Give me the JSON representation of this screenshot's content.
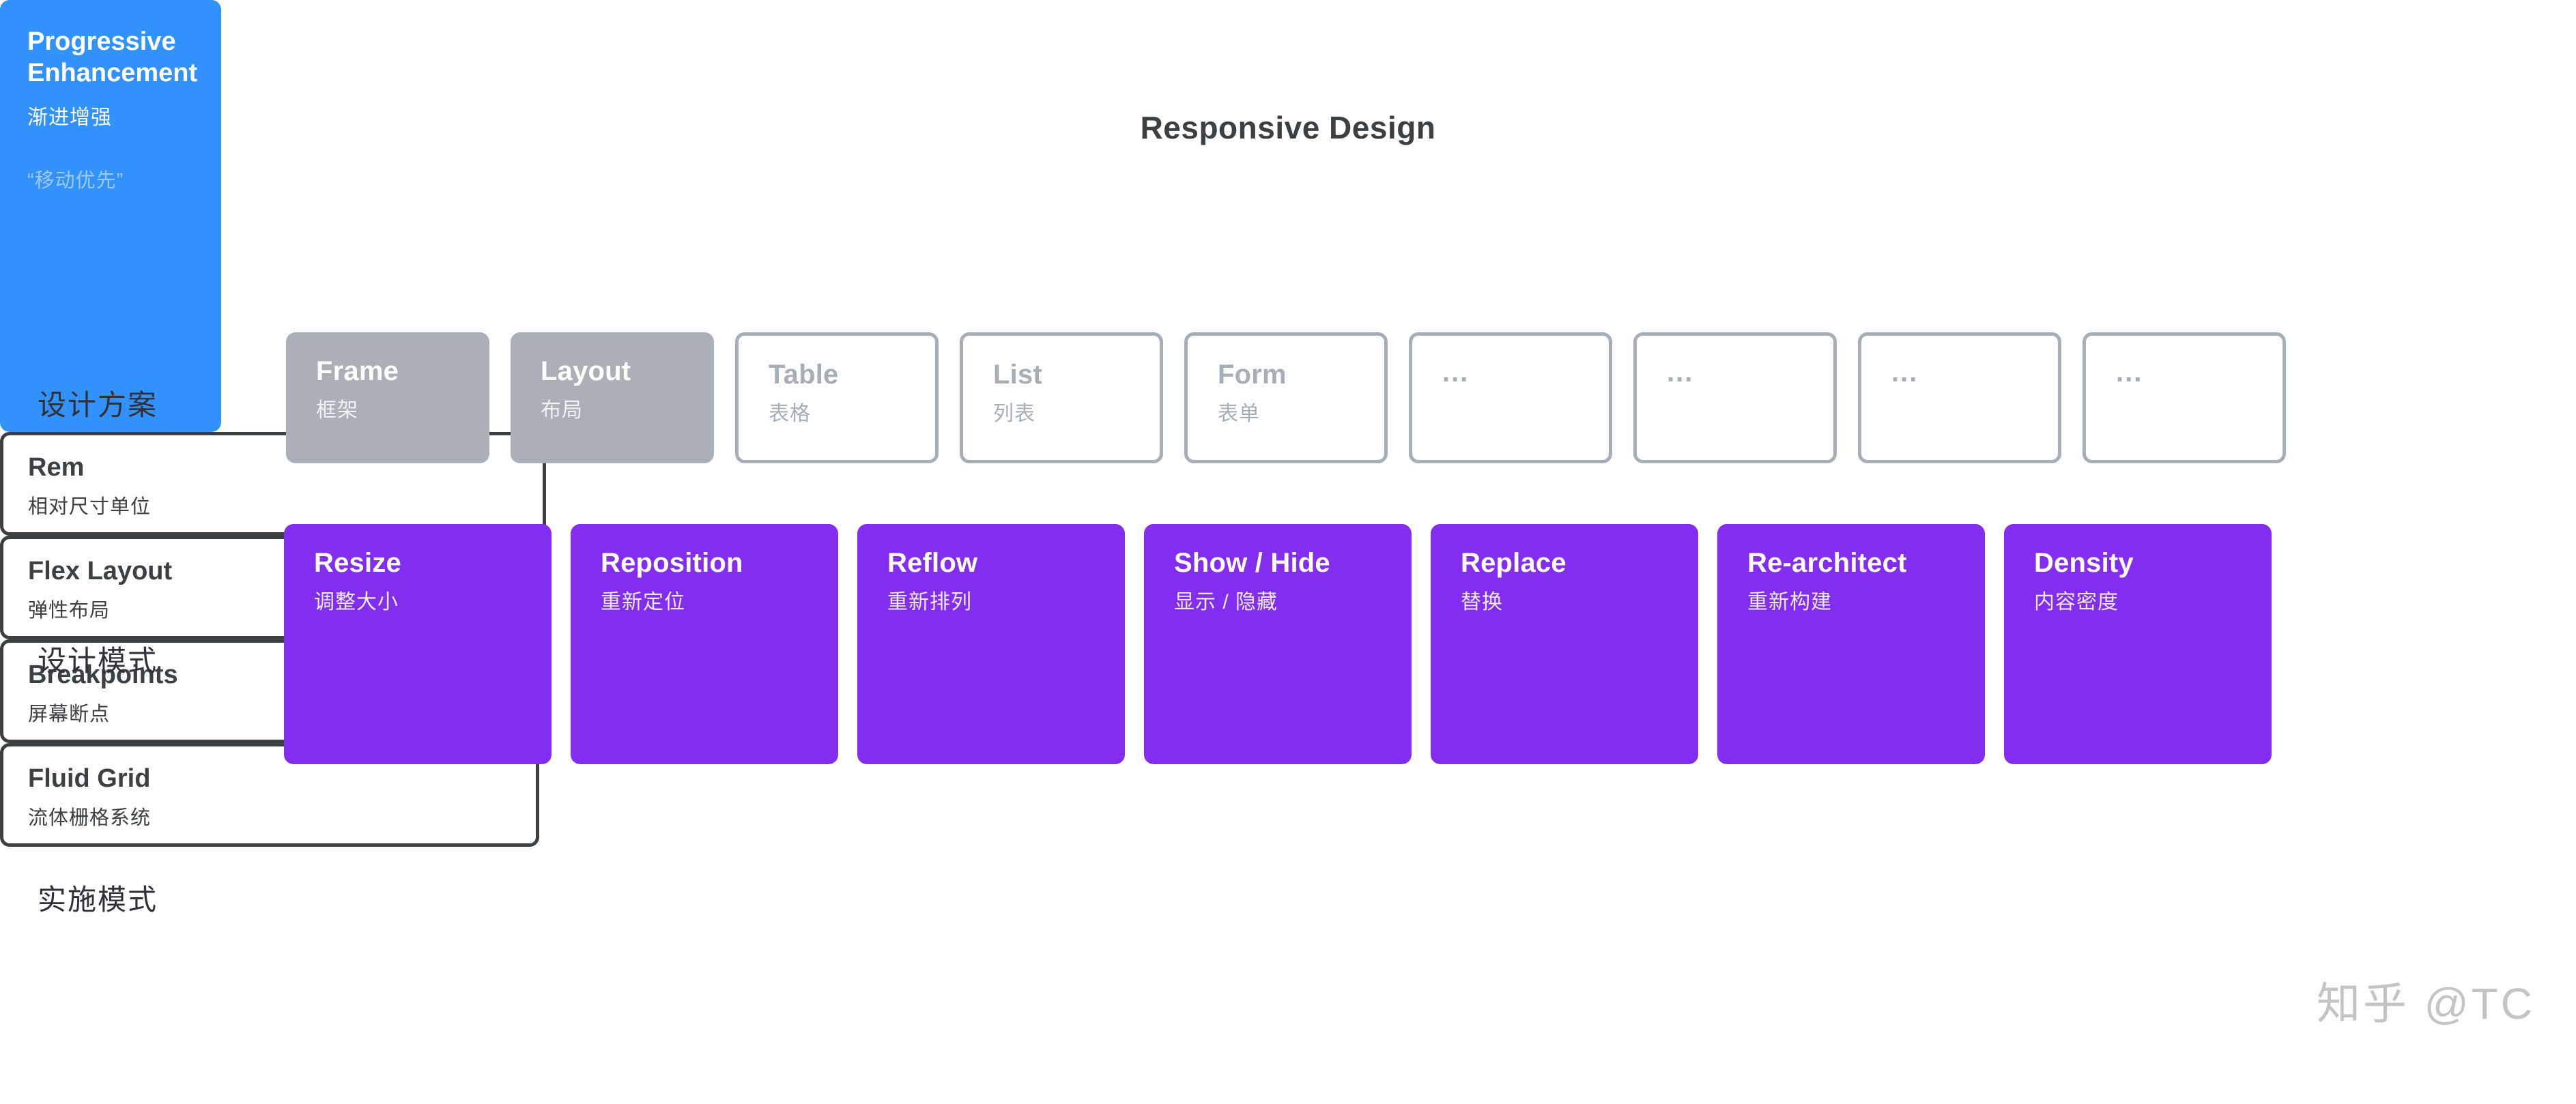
{
  "title": "Responsive Design",
  "colors": {
    "purple": "#822df0",
    "blue": "#3291fc",
    "gray": "#abb0b8",
    "outline_gray": "#a8aeb6",
    "dark": "#3c4043",
    "quote_blue": "#9dc9fc",
    "watermark": "#c2c4c6"
  },
  "watermark": "知乎 @TC",
  "rows": [
    {
      "label": "设计方案"
    },
    {
      "label": "设计模式"
    },
    {
      "label": "实施模式"
    }
  ],
  "solutions": [
    {
      "en": "Frame",
      "zh": "框架",
      "style": "filled"
    },
    {
      "en": "Layout",
      "zh": "布局",
      "style": "filled"
    },
    {
      "en": "Table",
      "zh": "表格",
      "style": "outlined"
    },
    {
      "en": "List",
      "zh": "列表",
      "style": "outlined"
    },
    {
      "en": "Form",
      "zh": "表单",
      "style": "outlined"
    },
    {
      "en": "...",
      "zh": "",
      "style": "empty"
    },
    {
      "en": "...",
      "zh": "",
      "style": "empty"
    },
    {
      "en": "...",
      "zh": "",
      "style": "empty"
    },
    {
      "en": "...",
      "zh": "",
      "style": "empty"
    }
  ],
  "progressive_enhancement": {
    "en": "Progressive\nEnhancement",
    "zh": "渐进增强",
    "quote": "“移动优先”"
  },
  "patterns": [
    {
      "en": "Resize",
      "zh": "调整大小"
    },
    {
      "en": "Reposition",
      "zh": "重新定位"
    },
    {
      "en": "Reflow",
      "zh": "重新排列"
    },
    {
      "en": "Show / Hide",
      "zh": "显示 / 隐藏"
    },
    {
      "en": "Replace",
      "zh": "替换"
    },
    {
      "en": "Re-architect",
      "zh": "重新构建"
    },
    {
      "en": "Density",
      "zh": "内容密度"
    }
  ],
  "implementations": [
    {
      "en": "Rem",
      "zh": "相对尺寸单位"
    },
    {
      "en": "Flex Layout",
      "zh": "弹性布局"
    },
    {
      "en": "Breakpoints",
      "zh": "屏幕断点"
    },
    {
      "en": "Fluid Grid",
      "zh": "流体栅格系统"
    }
  ]
}
